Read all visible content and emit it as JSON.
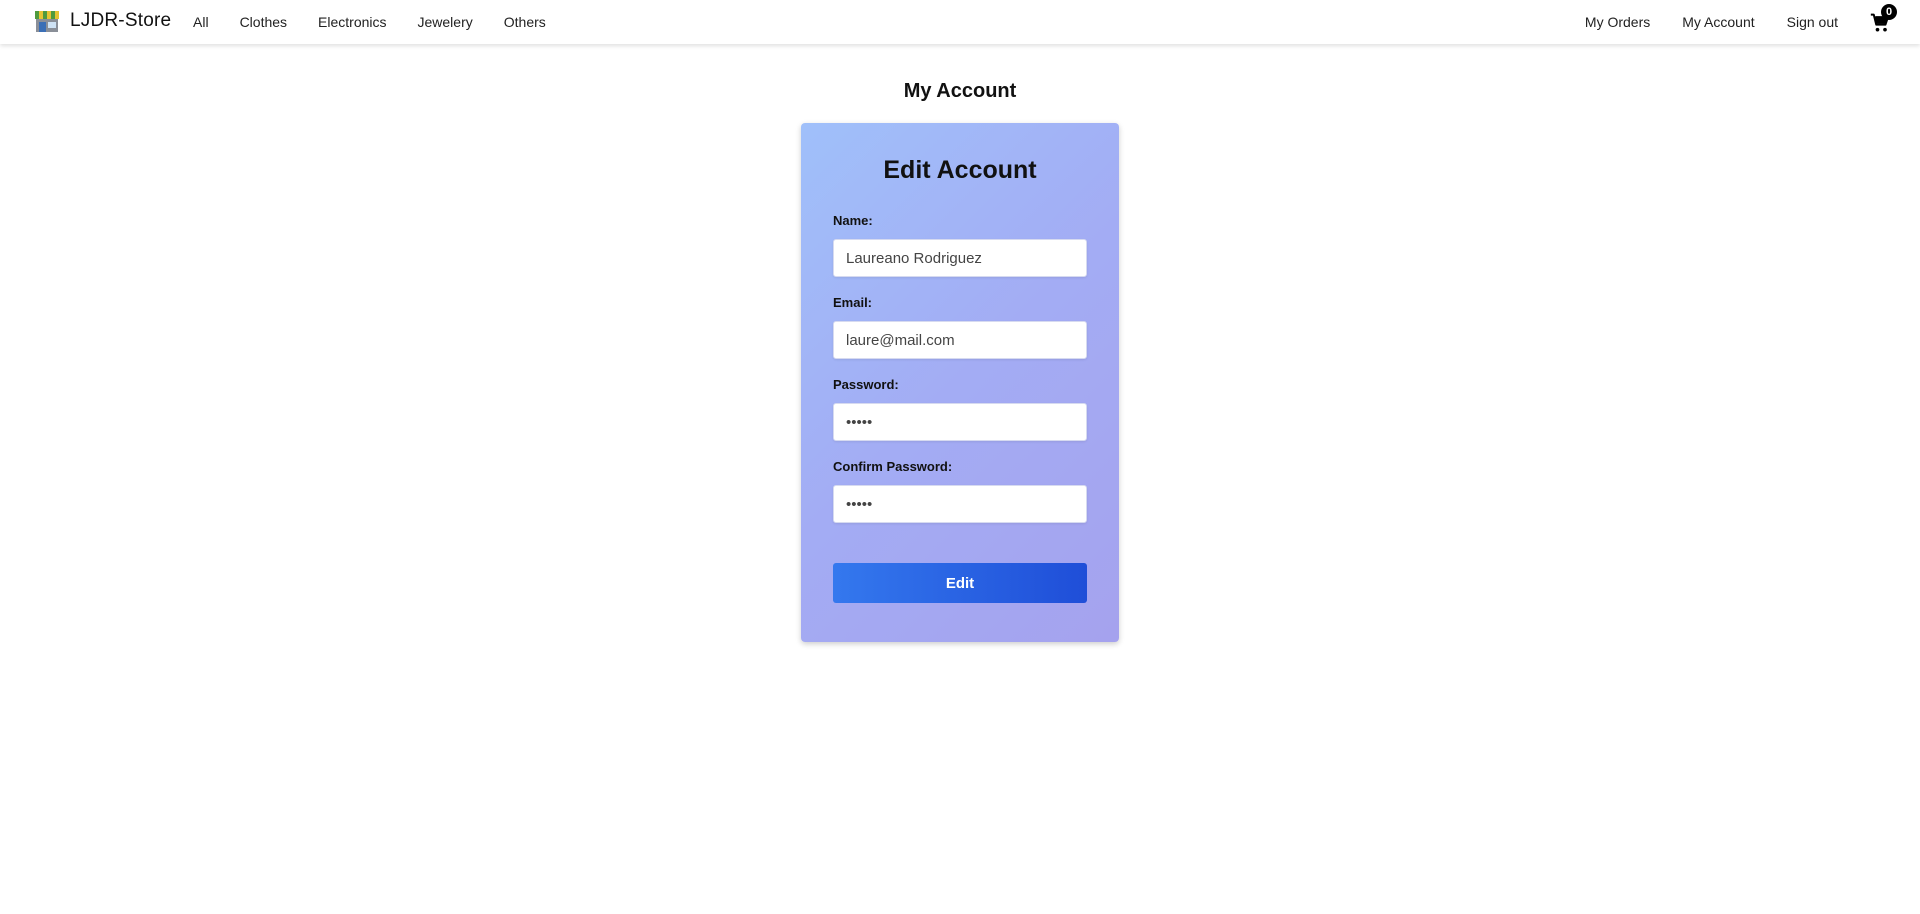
{
  "brand": {
    "name": "LJDR-Store",
    "logo_icon": "storefront-icon"
  },
  "nav": {
    "left": [
      "All",
      "Clothes",
      "Electronics",
      "Jewelery",
      "Others"
    ],
    "right": [
      "My Orders",
      "My Account",
      "Sign out"
    ],
    "cart_count": "0",
    "cart_icon": "shopping-cart-icon"
  },
  "page": {
    "title": "My Account"
  },
  "form": {
    "title": "Edit Account",
    "name_label": "Name:",
    "name_value": "Laureano Rodriguez",
    "email_label": "Email:",
    "email_value": "laure@mail.com",
    "password_label": "Password:",
    "password_value": "•••••",
    "confirm_label": "Confirm Password:",
    "confirm_value": "•••••",
    "submit_label": "Edit"
  },
  "colors": {
    "card_gradient_start": "#a0c0fa",
    "card_gradient_end": "#a5a2ee",
    "button_start": "#3478ee",
    "button_end": "#1f4ed8"
  }
}
